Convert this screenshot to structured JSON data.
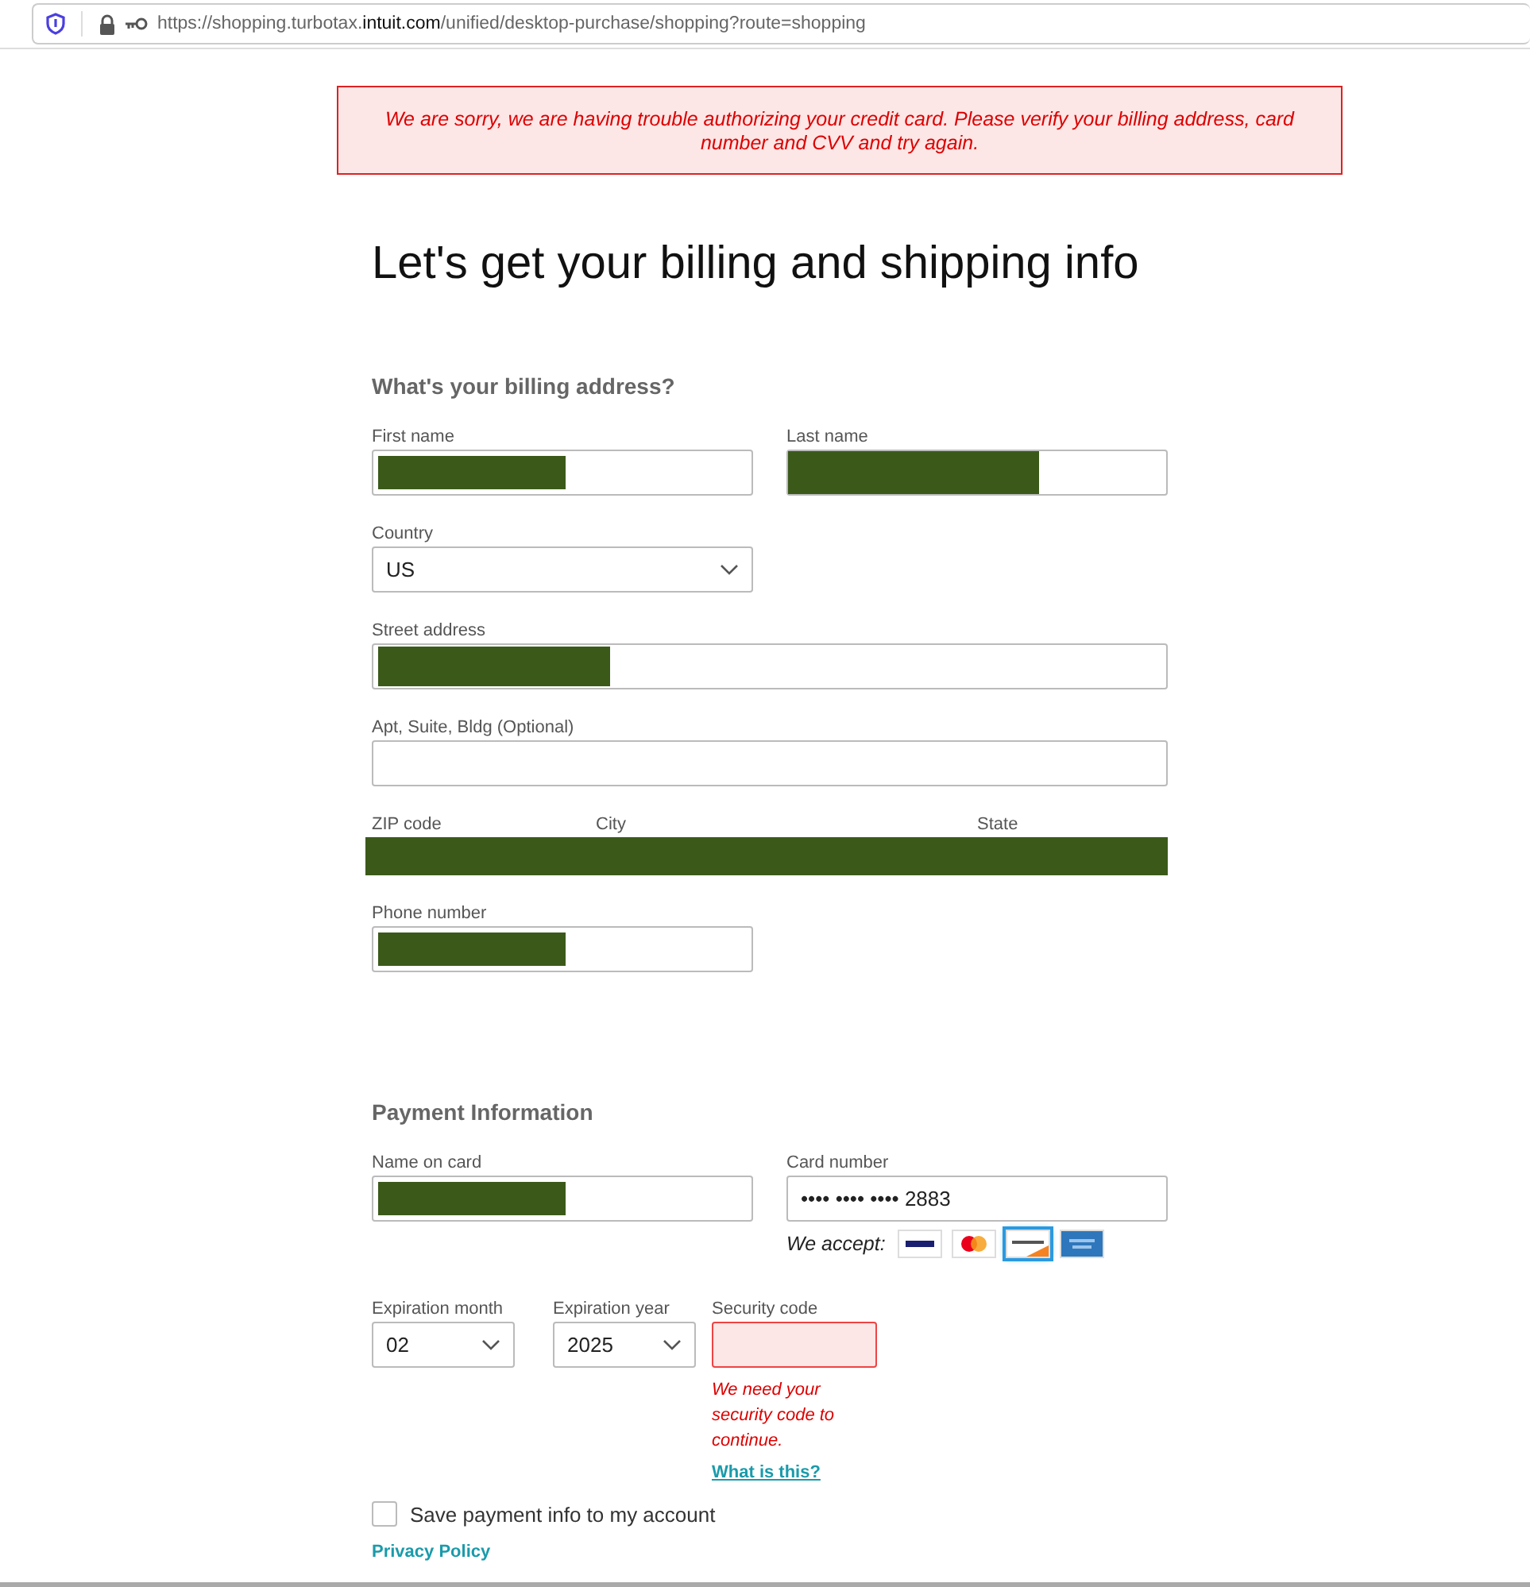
{
  "browser": {
    "url_prefix": "https://shopping.turbotax.",
    "url_domain": "intuit.com",
    "url_path": "/unified/desktop-purchase/shopping?route=shopping"
  },
  "alert": {
    "text": "We are sorry, we are having trouble authorizing your credit card. Please verify your billing address, card number and CVV and try again."
  },
  "title": "Let's get your billing and shipping info",
  "billing": {
    "heading": "What's your billing address?",
    "rows": [
      {
        "kind": "fields",
        "fields": [
          {
            "label": "First name",
            "kind": "text",
            "redacted": true
          },
          {
            "label": "Last name",
            "kind": "text",
            "redacted": true
          }
        ]
      },
      {
        "kind": "fields",
        "fields": [
          {
            "label": "Country",
            "kind": "select",
            "value": "US",
            "redacted": false
          }
        ]
      },
      {
        "kind": "fields",
        "fields": [
          {
            "label": "Street address",
            "kind": "text",
            "redacted": true,
            "wide": true
          }
        ]
      },
      {
        "kind": "fields",
        "fields": [
          {
            "label": "Apt, Suite, Bldg (Optional)",
            "kind": "text",
            "redacted": false,
            "wide": true
          }
        ]
      },
      {
        "kind": "covered",
        "labels": [
          "ZIP code",
          "City",
          "State"
        ]
      },
      {
        "kind": "fields",
        "fields": [
          {
            "label": "Phone number",
            "kind": "text",
            "redacted": true
          }
        ]
      }
    ]
  },
  "payment": {
    "heading": "Payment Information",
    "name_on_card": {
      "label": "Name on card",
      "redacted": true
    },
    "card_number": {
      "label": "Card number",
      "value": "•••• •••• •••• 2883"
    },
    "accept_label": "We accept:",
    "cards": [
      {
        "kind": "visa",
        "selected": false
      },
      {
        "kind": "mastercard",
        "selected": false
      },
      {
        "kind": "discover",
        "selected": true
      },
      {
        "kind": "amex",
        "selected": false
      }
    ],
    "expiration_month": {
      "label": "Expiration month",
      "value": "02"
    },
    "expiration_year": {
      "label": "Expiration year",
      "value": "2025"
    },
    "security_code": {
      "label": "Security code",
      "error": true,
      "error_text": "We need your security code to continue.",
      "help_link": "What is this?"
    },
    "save": {
      "label": "Save payment info to my account",
      "checked": false
    },
    "privacy_link": "Privacy Policy"
  }
}
